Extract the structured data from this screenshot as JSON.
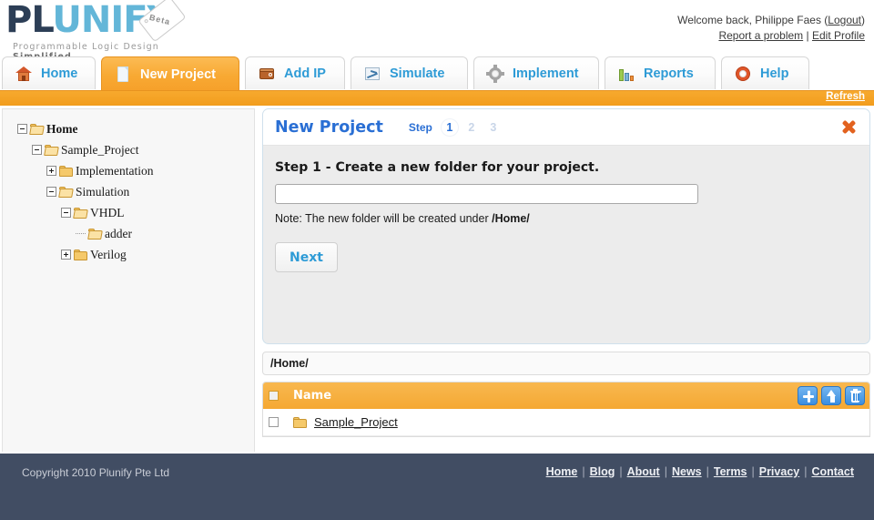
{
  "brand": {
    "name_part1": "PL",
    "name_part2": "UNIFY",
    "beta_label": "Beta",
    "tagline_normal": "Programmable Logic Design ",
    "tagline_bold": "Simplified"
  },
  "header": {
    "welcome_text": "Welcome back, Philippe Faes",
    "logout_open": "(",
    "logout_label": "Logout",
    "logout_close": ")",
    "report_label": "Report a problem",
    "separator": "|",
    "edit_profile_label": "Edit Profile"
  },
  "tabs": [
    {
      "label": "Home",
      "icon": "home-icon",
      "active": false
    },
    {
      "label": "New Project",
      "icon": "document-icon",
      "active": true
    },
    {
      "label": "Add IP",
      "icon": "chip-icon",
      "active": false
    },
    {
      "label": "Simulate",
      "icon": "waveform-icon",
      "active": false
    },
    {
      "label": "Implement",
      "icon": "gear-icon",
      "active": false
    },
    {
      "label": "Reports",
      "icon": "bar-chart-icon",
      "active": false
    },
    {
      "label": "Help",
      "icon": "lifebuoy-icon",
      "active": false
    }
  ],
  "toolbar": {
    "refresh_label": "Refresh"
  },
  "tree": {
    "nodes": [
      {
        "label": "Home",
        "state": "expanded",
        "bold": true,
        "open_folder": true,
        "depth": 0
      },
      {
        "label": "Sample_Project",
        "state": "expanded",
        "bold": false,
        "open_folder": true,
        "depth": 1
      },
      {
        "label": "Implementation",
        "state": "collapsed",
        "bold": false,
        "open_folder": false,
        "depth": 2
      },
      {
        "label": "Simulation",
        "state": "expanded",
        "bold": false,
        "open_folder": true,
        "depth": 2
      },
      {
        "label": "VHDL",
        "state": "expanded",
        "bold": false,
        "open_folder": true,
        "depth": 3
      },
      {
        "label": "adder",
        "state": "leaf",
        "bold": false,
        "open_folder": true,
        "depth": 4
      },
      {
        "label": "Verilog",
        "state": "collapsed",
        "bold": false,
        "open_folder": false,
        "depth": 3
      }
    ]
  },
  "panel": {
    "title": "New Project",
    "step_word": "Step",
    "steps": [
      "1",
      "2",
      "3"
    ],
    "active_step": "1",
    "close_icon": "close-icon",
    "step_heading": "Step 1 - Create a new folder for your project.",
    "folder_input_value": "",
    "folder_input_placeholder": "",
    "note_prefix": "Note: The new folder will be created under ",
    "note_path": "/Home/",
    "next_label": "Next"
  },
  "path_bar": {
    "path": "/Home/"
  },
  "file_table": {
    "header_checkbox_checked": true,
    "column_name": "Name",
    "actions": [
      {
        "name": "add-folder-button",
        "icon": "plus-icon"
      },
      {
        "name": "upload-button",
        "icon": "up-arrow-icon"
      },
      {
        "name": "delete-button",
        "icon": "trash-icon"
      }
    ],
    "rows": [
      {
        "checked": false,
        "icon": "folder-icon",
        "name": "Sample_Project"
      }
    ]
  },
  "footer": {
    "copyright": "Copyright 2010 Plunify Pte Ltd",
    "links": [
      "Home",
      "Blog",
      "About",
      "News",
      "Terms",
      "Privacy",
      "Contact"
    ],
    "separator": "|"
  },
  "colors": {
    "accent_orange": "#f5a833",
    "link_blue": "#2e9bd6",
    "title_blue": "#2a6fd4",
    "footer_bg": "#414d63",
    "logo_dark": "#2c3e56",
    "logo_light": "#63b6d8"
  }
}
